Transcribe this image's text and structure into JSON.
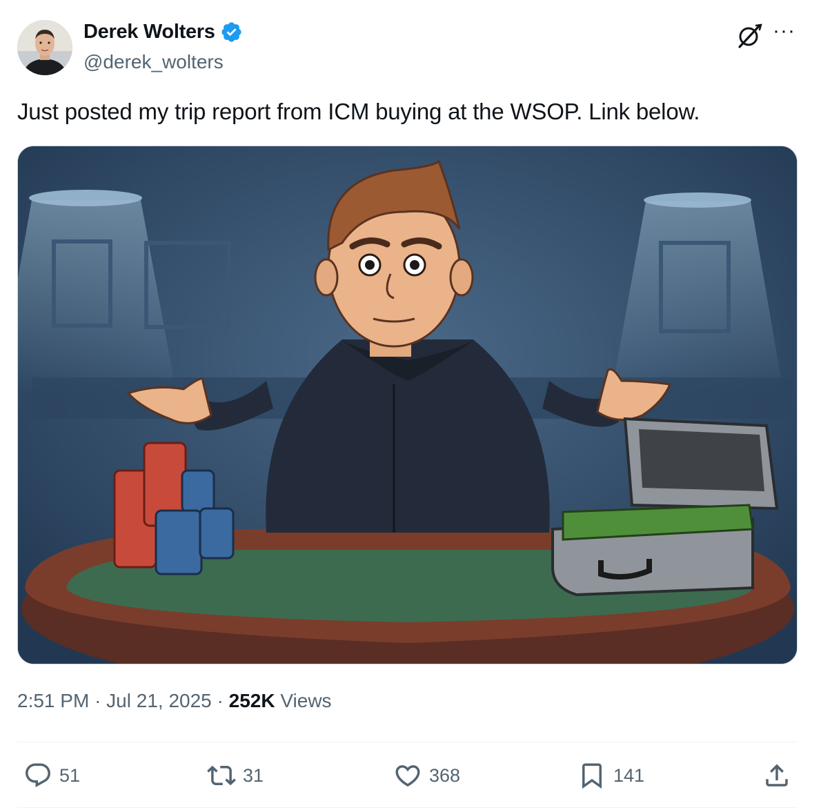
{
  "author": {
    "name": "Derek Wolters",
    "handle": "@derek_wolters",
    "verified": true
  },
  "tweet": {
    "text": "Just posted my trip report from ICM buying at the WSOP. Link below."
  },
  "meta": {
    "time": "2:51 PM",
    "separator": "·",
    "date": "Jul 21, 2025",
    "views_count": "252K",
    "views_label": "Views"
  },
  "actions": {
    "replies": "51",
    "reposts": "31",
    "likes": "368",
    "bookmarks": "141"
  },
  "icons": [
    "verified-badge-icon",
    "grok-icon",
    "more-icon",
    "reply-icon",
    "repost-icon",
    "like-icon",
    "bookmark-icon",
    "share-icon"
  ],
  "colors": {
    "verified": "#1d9bf0",
    "secondary_text": "#536471",
    "primary_text": "#0f1419"
  }
}
